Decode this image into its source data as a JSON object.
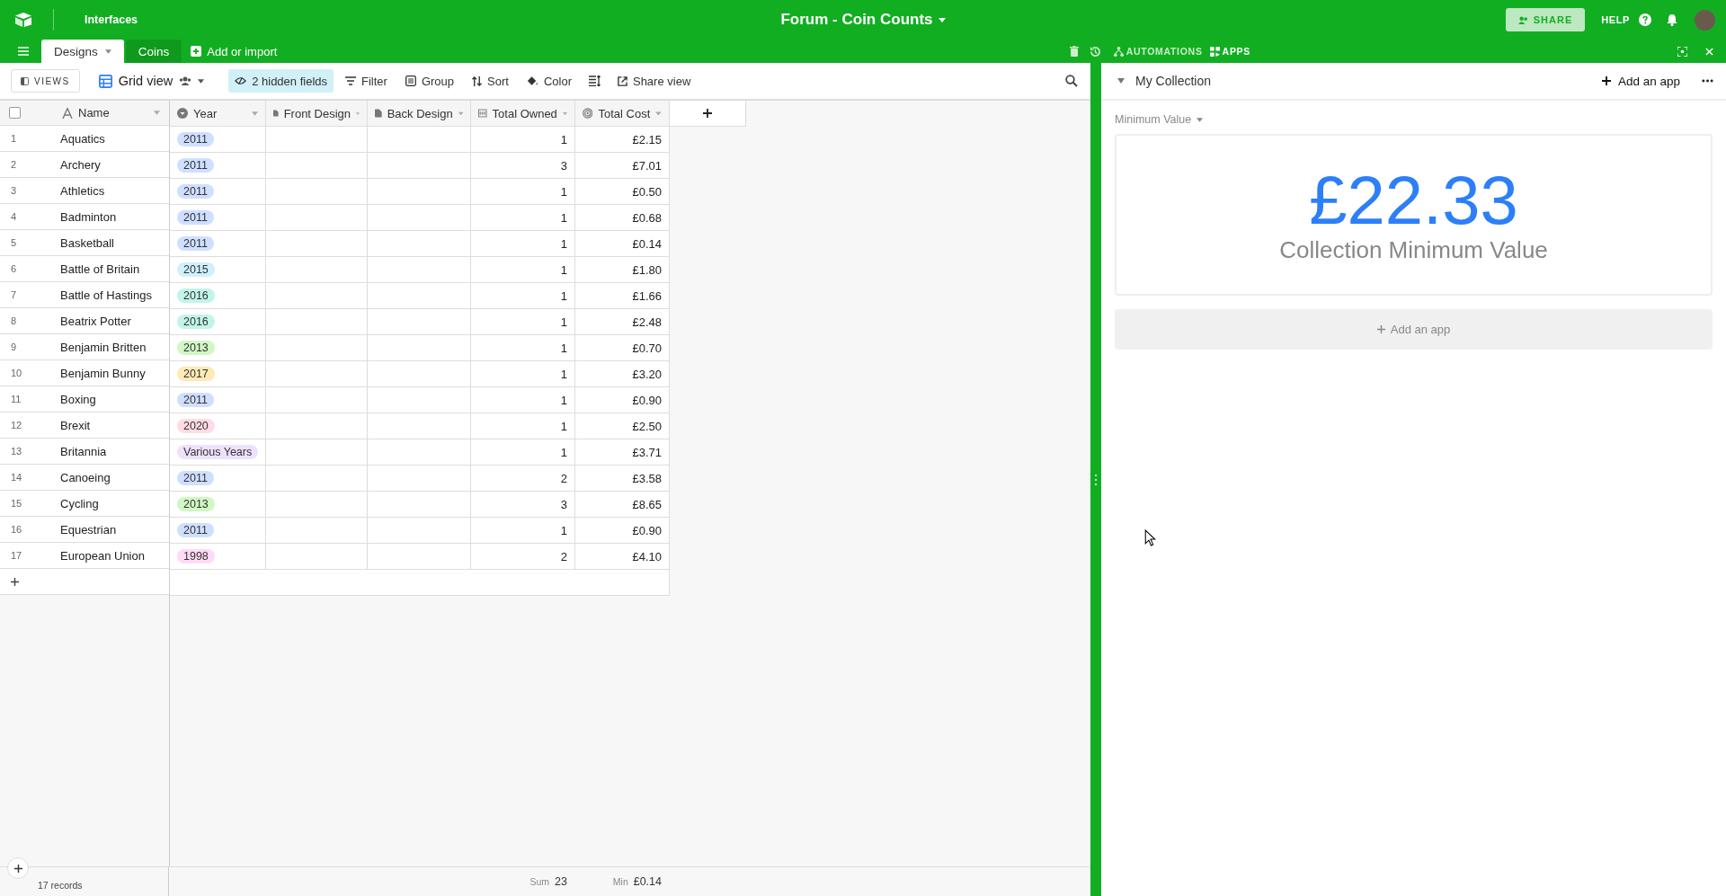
{
  "header": {
    "app_label": "Interfaces",
    "title": "Forum - Coin Counts",
    "share": "SHARE",
    "help": "HELP"
  },
  "tabs": [
    {
      "label": "Designs",
      "selected": true
    },
    {
      "label": "Coins",
      "selected": false
    }
  ],
  "add_table": "Add or import",
  "top_actions": [
    {
      "kind": "automations",
      "label": "AUTOMATIONS",
      "selected": false
    },
    {
      "kind": "apps",
      "label": "APPS",
      "selected": true
    }
  ],
  "toolbar": {
    "views": "VIEWS",
    "view_name": "Grid view",
    "hidden_fields": "2 hidden fields",
    "buttons": [
      {
        "kind": "filter",
        "label": "Filter"
      },
      {
        "kind": "group",
        "label": "Group"
      },
      {
        "kind": "sort",
        "label": "Sort"
      },
      {
        "kind": "color",
        "label": "Color"
      },
      {
        "kind": "row_height"
      },
      {
        "kind": "share",
        "label": "Share view"
      }
    ]
  },
  "table": {
    "select_all": {
      "checked": false
    },
    "columns": [
      {
        "kind": "text",
        "label": "Name"
      },
      {
        "kind": "select",
        "label": "Year"
      },
      {
        "kind": "attachment",
        "label": "Front Design"
      },
      {
        "kind": "attachment",
        "label": "Back Design"
      },
      {
        "kind": "count",
        "label": "Total Owned"
      },
      {
        "kind": "rollup",
        "label": "Total Cost"
      }
    ],
    "rows": [
      {
        "num": "1",
        "name": "Aquatics",
        "year": {
          "label": "2011",
          "color": "#cfdfff"
        },
        "owned": "1",
        "cost": "£2.15"
      },
      {
        "num": "2",
        "name": "Archery",
        "year": {
          "label": "2011",
          "color": "#cfdfff"
        },
        "owned": "3",
        "cost": "£7.01"
      },
      {
        "num": "3",
        "name": "Athletics",
        "year": {
          "label": "2011",
          "color": "#cfdfff"
        },
        "owned": "1",
        "cost": "£0.50"
      },
      {
        "num": "4",
        "name": "Badminton",
        "year": {
          "label": "2011",
          "color": "#cfdfff"
        },
        "owned": "1",
        "cost": "£0.68"
      },
      {
        "num": "5",
        "name": "Basketball",
        "year": {
          "label": "2011",
          "color": "#cfdfff"
        },
        "owned": "1",
        "cost": "£0.14"
      },
      {
        "num": "6",
        "name": "Battle of Britain",
        "year": {
          "label": "2015",
          "color": "#d0f0fd"
        },
        "owned": "1",
        "cost": "£1.80"
      },
      {
        "num": "7",
        "name": "Battle of Hastings",
        "year": {
          "label": "2016",
          "color": "#c2f5e9"
        },
        "owned": "1",
        "cost": "£1.66"
      },
      {
        "num": "8",
        "name": "Beatrix Potter",
        "year": {
          "label": "2016",
          "color": "#c2f5e9"
        },
        "owned": "1",
        "cost": "£2.48"
      },
      {
        "num": "9",
        "name": "Benjamin Britten",
        "year": {
          "label": "2013",
          "color": "#d1f7c4"
        },
        "owned": "1",
        "cost": "£0.70"
      },
      {
        "num": "10",
        "name": "Benjamin Bunny",
        "year": {
          "label": "2017",
          "color": "#ffeab6"
        },
        "owned": "1",
        "cost": "£3.20"
      },
      {
        "num": "11",
        "name": "Boxing",
        "year": {
          "label": "2011",
          "color": "#cfdfff"
        },
        "owned": "1",
        "cost": "£0.90"
      },
      {
        "num": "12",
        "name": "Brexit",
        "year": {
          "label": "2020",
          "color": "#ffdce5"
        },
        "owned": "1",
        "cost": "£2.50"
      },
      {
        "num": "13",
        "name": "Britannia",
        "year": {
          "label": "Various Years",
          "color": "#ede2fe"
        },
        "owned": "1",
        "cost": "£3.71"
      },
      {
        "num": "14",
        "name": "Canoeing",
        "year": {
          "label": "2011",
          "color": "#cfdfff"
        },
        "owned": "2",
        "cost": "£3.58"
      },
      {
        "num": "15",
        "name": "Cycling",
        "year": {
          "label": "2013",
          "color": "#d1f7c4"
        },
        "owned": "3",
        "cost": "£8.65"
      },
      {
        "num": "16",
        "name": "Equestrian",
        "year": {
          "label": "2011",
          "color": "#cfdfff"
        },
        "owned": "1",
        "cost": "£0.90"
      },
      {
        "num": "17",
        "name": "European Union",
        "year": {
          "label": "1998",
          "color": "#ffdaf6"
        },
        "owned": "2",
        "cost": "£4.10"
      }
    ],
    "footer": {
      "records": "17 records",
      "sum_label": "Sum",
      "sum": "23",
      "min_label": "Min",
      "min": "£0.14"
    }
  },
  "panel": {
    "title": "My Collection",
    "add_app": "Add an app",
    "field_label": "Minimum Value",
    "value": "£22.33",
    "caption": "Collection Minimum Value",
    "add_app_bar": "Add an app"
  }
}
